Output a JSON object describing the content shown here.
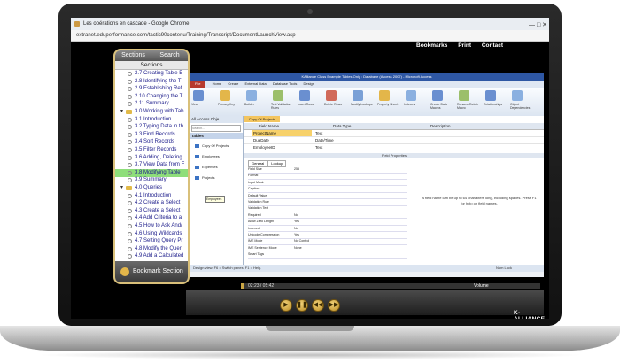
{
  "browser": {
    "title": "Les opérations en cascade - Google Chrome",
    "url": "extranet.eduperformance.com/tactic90contenu/Training/Transcript/DocumentLaunchView.asp"
  },
  "topnav": [
    "Bookmarks",
    "Print",
    "Contact"
  ],
  "panel": {
    "tabs": [
      "Sections",
      "Search"
    ],
    "heading": "Sections",
    "items": [
      {
        "label": "2.7 Creating Table E",
        "kind": "lesson"
      },
      {
        "label": "2.8 Identifying the T",
        "kind": "lesson"
      },
      {
        "label": "2.9 Establishing Ref",
        "kind": "lesson"
      },
      {
        "label": "2.10 Changing the T",
        "kind": "lesson"
      },
      {
        "label": "2.11 Summary",
        "kind": "lesson"
      },
      {
        "label": "3.0 Working with Tab",
        "kind": "folder"
      },
      {
        "label": "3.1 Introduction",
        "kind": "lesson"
      },
      {
        "label": "3.2 Typing Data in th",
        "kind": "lesson"
      },
      {
        "label": "3.3 Find Records",
        "kind": "lesson"
      },
      {
        "label": "3.4 Sort Records",
        "kind": "lesson"
      },
      {
        "label": "3.5 Filter Records",
        "kind": "lesson"
      },
      {
        "label": "3.6 Adding, Deleting",
        "kind": "lesson"
      },
      {
        "label": "3.7 View Data from F",
        "kind": "lesson"
      },
      {
        "label": "3.8 Modifying Table",
        "kind": "lesson",
        "selected": true
      },
      {
        "label": "3.9 Summary",
        "kind": "lesson"
      },
      {
        "label": "4.0 Queries",
        "kind": "folder"
      },
      {
        "label": "4.1 Introduction",
        "kind": "lesson"
      },
      {
        "label": "4.2 Create a Select",
        "kind": "lesson"
      },
      {
        "label": "4.3 Create a Select",
        "kind": "lesson"
      },
      {
        "label": "4.4 Add Criteria to a",
        "kind": "lesson"
      },
      {
        "label": "4.5 How to Ask And/",
        "kind": "lesson"
      },
      {
        "label": "4.6 Using Wildcards",
        "kind": "lesson"
      },
      {
        "label": "4.7 Setting Query Pr",
        "kind": "lesson"
      },
      {
        "label": "4.8 Modify the Quer",
        "kind": "lesson"
      },
      {
        "label": "4.9 Add a Calculated",
        "kind": "lesson"
      }
    ],
    "footer": "Bookmark Section"
  },
  "access": {
    "title": "KAlliance Class Example Tables Only : Database (Access 2007) - Microsoft Access",
    "tabs": [
      "File",
      "Home",
      "Create",
      "External Data",
      "Database Tools",
      "Design"
    ],
    "ribbon": [
      "View",
      "Primary Key",
      "Builder",
      "Test Validation Rules",
      "Insert Rows",
      "Delete Rows",
      "Modify Lookups",
      "Property Sheet",
      "Indexes",
      "Create Data Macros",
      "Rename/Delete Macro",
      "Relationships",
      "Object Dependencies"
    ],
    "nav_header": "All Access Obje...",
    "nav_search": "Search...",
    "nav_group": "Tables",
    "nav_items": [
      "Copy Of Projects",
      "Employees",
      "Expenses",
      "Projects"
    ],
    "tooltip": "Employees",
    "doc_tab": "Copy Of Projects",
    "columns": [
      "Field Name",
      "Data Type",
      "Description"
    ],
    "fields": [
      {
        "name": "ProjectName",
        "type": "Text"
      },
      {
        "name": "DueDate",
        "type": "Date/Time"
      },
      {
        "name": "EmployeeID",
        "type": "Text"
      }
    ],
    "field_props_title": "Field Properties",
    "prop_tabs": [
      "General",
      "Lookup"
    ],
    "props": [
      {
        "k": "Field Size",
        "v": "255"
      },
      {
        "k": "Format",
        "v": ""
      },
      {
        "k": "Input Mask",
        "v": ""
      },
      {
        "k": "Caption",
        "v": ""
      },
      {
        "k": "Default Value",
        "v": ""
      },
      {
        "k": "Validation Rule",
        "v": ""
      },
      {
        "k": "Validation Text",
        "v": ""
      },
      {
        "k": "Required",
        "v": "No"
      },
      {
        "k": "Allow Zero Length",
        "v": "Yes"
      },
      {
        "k": "Indexed",
        "v": "No"
      },
      {
        "k": "Unicode Compression",
        "v": "Yes"
      },
      {
        "k": "IME Mode",
        "v": "No Control"
      },
      {
        "k": "IME Sentence Mode",
        "v": "None"
      },
      {
        "k": "Smart Tags",
        "v": ""
      }
    ],
    "help": "A field name can be up to 64 characters long, including spaces. Press F1 for help on field names.",
    "status_left": "Design view. F6 = Switch panes. F1 = Help.",
    "status_right": "Num Lock"
  },
  "player": {
    "time": "02:23 / 05:42",
    "progress_fraction": 0.01,
    "volume_label": "Volume",
    "logo": "K-ALLIANCE"
  }
}
